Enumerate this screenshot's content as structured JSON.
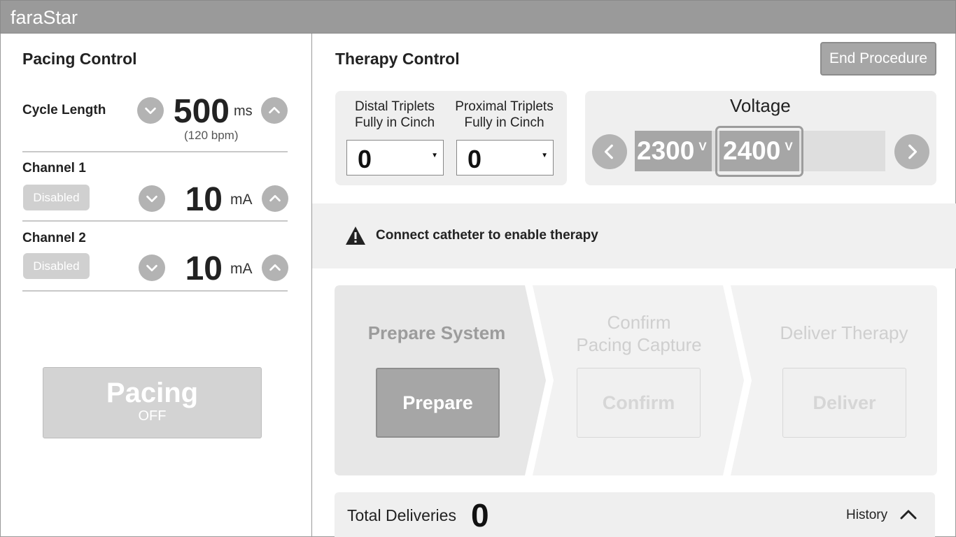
{
  "app": {
    "title": "faraStar"
  },
  "pacing": {
    "title": "Pacing Control",
    "cycle_length": {
      "label": "Cycle Length",
      "value": "500",
      "unit": "ms",
      "bpm_text": "(120  bpm)"
    },
    "channel1": {
      "label": "Channel 1",
      "status": "Disabled",
      "value": "10",
      "unit": "mA"
    },
    "channel2": {
      "label": "Channel 2",
      "status": "Disabled",
      "value": "10",
      "unit": "mA"
    },
    "pacing_button": {
      "title": "Pacing",
      "state": "OFF"
    }
  },
  "therapy": {
    "title": "Therapy Control",
    "end_button": "End Procedure",
    "distal": {
      "label_line1": "Distal Triplets",
      "label_line2": "Fully in Cinch",
      "value": "0"
    },
    "proximal": {
      "label_line1": "Proximal Triplets",
      "label_line2": "Fully in Cinch",
      "value": "0"
    },
    "voltage": {
      "title": "Voltage",
      "options": [
        {
          "value": "2300",
          "unit": "V"
        },
        {
          "value": "2400",
          "unit": "V"
        }
      ],
      "selected": "2400"
    },
    "banner_text": "Connect catheter to enable therapy",
    "steps": [
      {
        "title_line1": "Prepare System",
        "title_line2": "",
        "button": "Prepare"
      },
      {
        "title_line1": "Confirm",
        "title_line2": "Pacing Capture",
        "button": "Confirm"
      },
      {
        "title_line1": "Deliver Therapy",
        "title_line2": "",
        "button": "Deliver"
      }
    ],
    "deliveries": {
      "label": "Total Deliveries",
      "value": "0",
      "history_label": "History"
    }
  },
  "icons": {
    "decrement": "chevron-down-icon",
    "increment": "chevron-up-icon",
    "voltage_prev": "chevron-left-icon",
    "voltage_next": "chevron-right-icon",
    "warning": "warning-triangle-icon",
    "history_toggle": "chevron-up-icon"
  },
  "colors": {
    "titlebar": "#9a9a9a",
    "active_button": "#a6a6a6",
    "disabled": "#d0d0d0",
    "panel_bg": "#efefef"
  }
}
